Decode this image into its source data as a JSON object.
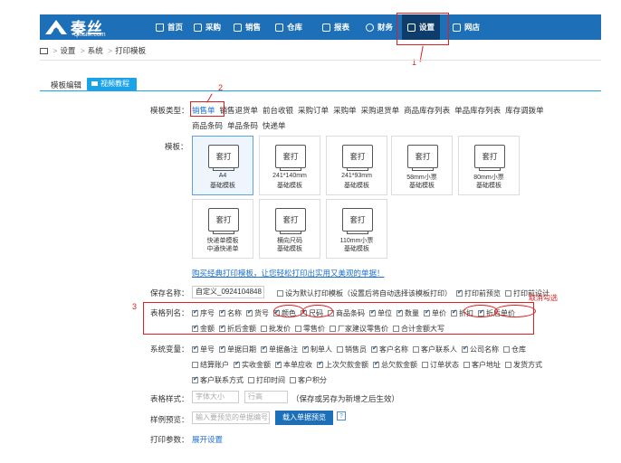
{
  "brand": {
    "name": "秦丝",
    "url": "qinsilk.com"
  },
  "nav": {
    "items": [
      {
        "label": "首页",
        "icon": "home-icon"
      },
      {
        "label": "采购",
        "icon": "purchase-icon"
      },
      {
        "label": "销售",
        "icon": "sales-icon"
      },
      {
        "label": "仓库",
        "icon": "warehouse-icon"
      },
      {
        "label": "报表",
        "icon": "report-icon"
      },
      {
        "label": "财务",
        "icon": "finance-icon"
      },
      {
        "label": "设置",
        "icon": "settings-icon"
      },
      {
        "label": "网店",
        "icon": "shop-icon"
      }
    ]
  },
  "breadcrumb": {
    "home_icon": "home-icon",
    "items": [
      "设置",
      "系统",
      "打印模板"
    ]
  },
  "tabs": {
    "template_edit": "模板编辑",
    "video": "视频教程"
  },
  "annotations": {
    "n1": "1",
    "n2": "2",
    "n3": "3",
    "cancel_note": "取消勾选"
  },
  "form": {
    "type_label": "模板类型：",
    "types": [
      "销售单",
      "销售退货单",
      "前台收银",
      "采购订单",
      "采购单",
      "采购退货单",
      "商品库存列表",
      "单品库存列表",
      "库存调拨单",
      "商品条码",
      "单品条码",
      "快递单"
    ],
    "template_label": "模板：",
    "templates": [
      {
        "paper": "套打",
        "line1": "A4",
        "line2": "基础模板"
      },
      {
        "paper": "套打",
        "line1": "241*140mm",
        "line2": "基础模板"
      },
      {
        "paper": "套打",
        "line1": "241*93mm",
        "line2": "基础模板"
      },
      {
        "paper": "套打",
        "line1": "58mm小票",
        "line2": "基础模板"
      },
      {
        "paper": "套打",
        "line1": "80mm小票",
        "line2": "基础模板"
      },
      {
        "paper": "套打",
        "line1": "快递单模板",
        "line2": "中通快递单"
      },
      {
        "paper": "套打",
        "line1": "横向尺码",
        "line2": "基础模板"
      },
      {
        "paper": "套打",
        "line1": "110mm小票",
        "line2": "基础模板"
      }
    ],
    "buy_link": "购买经典打印模板，让您轻松打印出实用又美观的单据！",
    "save_label": "保存名称：",
    "save_value": "自定义_0924104848",
    "save_options": [
      {
        "label": "设为默认打印模板（设置后将自动选择该模板打印）",
        "checked": false
      },
      {
        "label": "打印前预览",
        "checked": true
      },
      {
        "label": "打印前设计",
        "checked": false
      }
    ],
    "columns_label": "表格列名：",
    "columns_row1": [
      {
        "label": "序号",
        "checked": true
      },
      {
        "label": "名称",
        "checked": true
      },
      {
        "label": "货号",
        "checked": true
      },
      {
        "label": "颜色",
        "checked": true
      },
      {
        "label": "尺码",
        "checked": true
      },
      {
        "label": "商品条码",
        "checked": false
      },
      {
        "label": "单位",
        "checked": true
      },
      {
        "label": "数量",
        "checked": true
      },
      {
        "label": "单价",
        "checked": true
      },
      {
        "label": "折扣",
        "checked": true
      },
      {
        "label": "折后单价",
        "checked": true
      }
    ],
    "columns_row2": [
      {
        "label": "金额",
        "checked": true
      },
      {
        "label": "折后金额",
        "checked": true
      },
      {
        "label": "批发价",
        "checked": false
      },
      {
        "label": "零售价",
        "checked": false
      },
      {
        "label": "厂家建议零售价",
        "checked": false
      },
      {
        "label": "合计金额大写",
        "checked": false
      }
    ],
    "vars_label": "系统变量：",
    "vars_row1": [
      {
        "label": "单号",
        "checked": true
      },
      {
        "label": "单据日期",
        "checked": true
      },
      {
        "label": "单据备注",
        "checked": true
      },
      {
        "label": "制单人",
        "checked": true
      },
      {
        "label": "销售员",
        "checked": false
      },
      {
        "label": "客户名称",
        "checked": true
      },
      {
        "label": "客户联系人",
        "checked": false
      },
      {
        "label": "公司名称",
        "checked": true
      },
      {
        "label": "仓库",
        "checked": false
      }
    ],
    "vars_row2": [
      {
        "label": "结算账户",
        "checked": false
      },
      {
        "label": "实收金额",
        "checked": true
      },
      {
        "label": "本单应收",
        "checked": true
      },
      {
        "label": "上次欠款金额",
        "checked": true
      },
      {
        "label": "总欠款金额",
        "checked": true
      },
      {
        "label": "订单状态",
        "checked": false
      },
      {
        "label": "客户地址",
        "checked": false
      },
      {
        "label": "发货方式",
        "checked": false
      }
    ],
    "vars_row3": [
      {
        "label": "客户联系方式",
        "checked": true
      },
      {
        "label": "打印时间",
        "checked": false
      },
      {
        "label": "客户积分",
        "checked": false
      }
    ],
    "style_label": "表格样式：",
    "font_size_placeholder": "字体大小",
    "row_height_placeholder": "行高",
    "style_note": "（保存或另存为新增之后生效）",
    "preview_label": "样例预览：",
    "preview_placeholder": "输入要预览的单据编号...",
    "preview_button": "载入单据预览",
    "help": "?",
    "params_label": "打印参数：",
    "params_link": "展开设置"
  }
}
